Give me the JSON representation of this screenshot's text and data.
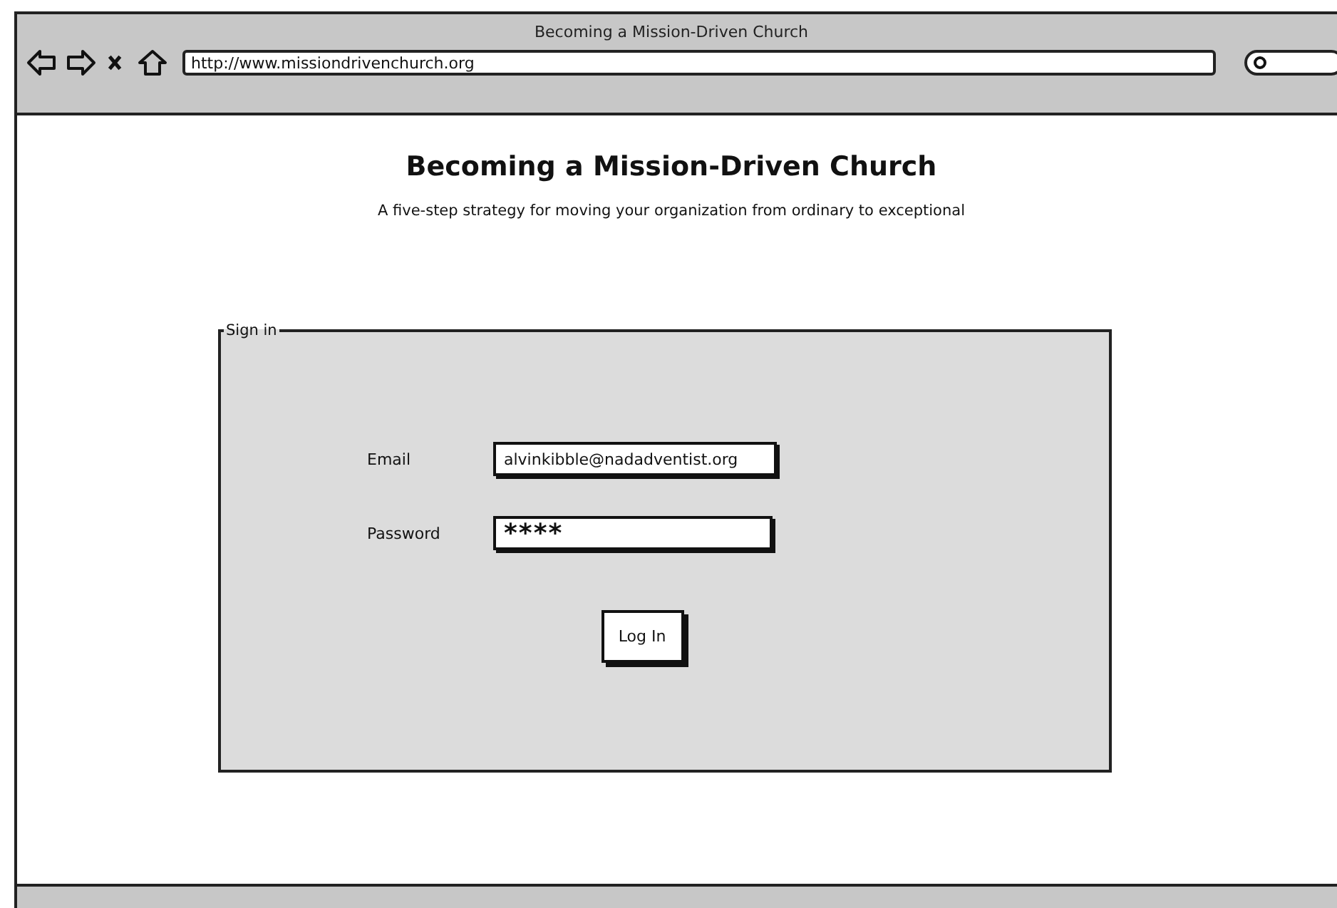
{
  "window": {
    "title": "Becoming a Mission-Driven Church"
  },
  "address_bar": {
    "value": "http://www.missiondrivenchurch.org"
  },
  "page": {
    "heading": "Becoming a Mission-Driven Church",
    "subheading": "A five-step strategy for moving your organization from ordinary to exceptional"
  },
  "sign_in": {
    "legend": "Sign in",
    "fields": [
      {
        "label": "Email",
        "value": "alvinkibble@nadadventist.org",
        "kind": "text"
      },
      {
        "label": "Password",
        "value": "****",
        "kind": "password"
      }
    ],
    "button": "Log In"
  }
}
